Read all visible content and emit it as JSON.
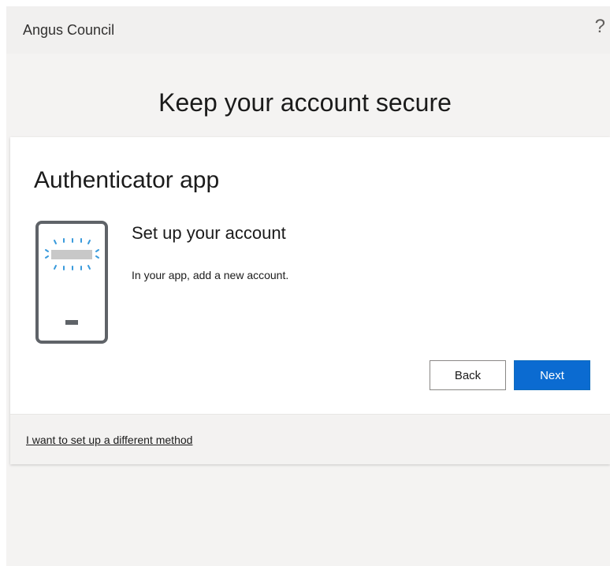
{
  "header": {
    "org_name": "Angus Council",
    "help_label": "?"
  },
  "main": {
    "heading": "Keep your account secure"
  },
  "card": {
    "title": "Authenticator app",
    "step_title": "Set up your account",
    "step_text": "In your app, add a new account.",
    "back_label": "Back",
    "next_label": "Next",
    "alt_method_link": "I want to set up a different method"
  },
  "colors": {
    "primary": "#0b6bd1",
    "page_background": "#f4f3f2",
    "topbar_background": "#f1f0ef",
    "card_background": "#ffffff",
    "phone_outline": "#5f6368",
    "phone_highlight": "#3a9bdc"
  },
  "icons": {
    "help": "question-mark-icon",
    "illustration": "phone-authenticator-icon"
  }
}
